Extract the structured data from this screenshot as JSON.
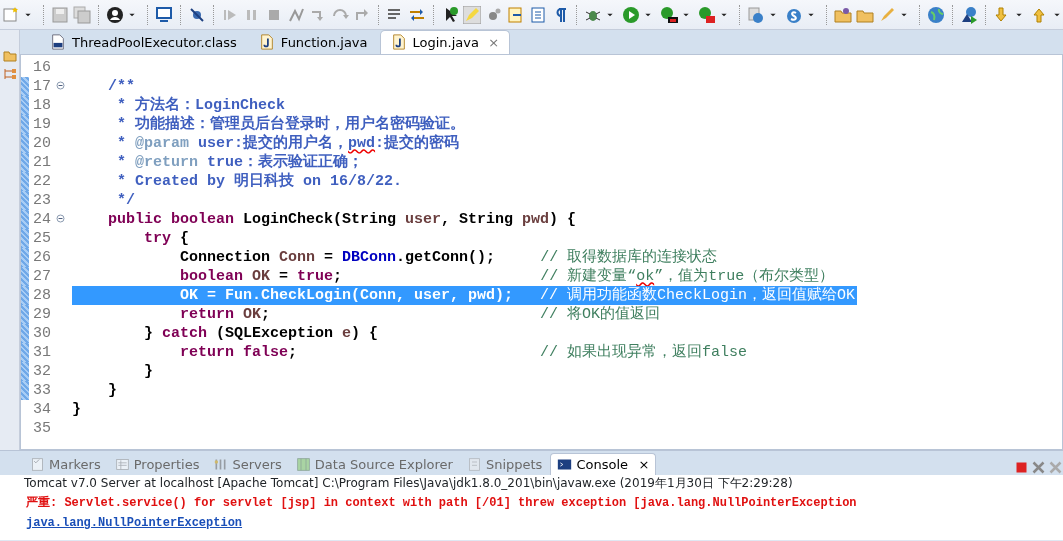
{
  "editor_tabs": [
    {
      "label": "ThreadPoolExecutor.class",
      "kind": "class",
      "selected": false
    },
    {
      "label": "Function.java",
      "kind": "java",
      "selected": false
    },
    {
      "label": "Login.java",
      "kind": "java",
      "selected": true,
      "close": "×"
    }
  ],
  "code_lines": [
    {
      "number": "16",
      "foldable": false,
      "changed": false,
      "selected": false
    },
    {
      "number": "17",
      "foldable": true,
      "changed": true,
      "selected": false,
      "tokens": [
        {
          "kind": "doc",
          "text": "    /**"
        }
      ]
    },
    {
      "number": "18",
      "foldable": false,
      "changed": true,
      "selected": false,
      "tokens": [
        {
          "kind": "doc",
          "text": "     * 方法名：LoginCheck"
        }
      ]
    },
    {
      "number": "19",
      "foldable": false,
      "changed": true,
      "selected": false,
      "tokens": [
        {
          "kind": "doc",
          "text": "     * 功能描述：管理员后台登录时，用户名密码验证。"
        }
      ]
    },
    {
      "number": "20",
      "foldable": false,
      "changed": true,
      "selected": false,
      "tokens": [
        {
          "kind": "doc",
          "text": "     * "
        },
        {
          "kind": "tag",
          "text": "@param"
        },
        {
          "kind": "doc",
          "text": " user:提交的用户名，"
        },
        {
          "kind": "doc-typo",
          "text": "pwd"
        },
        {
          "kind": "doc",
          "text": ":提交的密码"
        }
      ]
    },
    {
      "number": "21",
      "foldable": false,
      "changed": true,
      "selected": false,
      "tokens": [
        {
          "kind": "doc",
          "text": "     * "
        },
        {
          "kind": "tag",
          "text": "@return"
        },
        {
          "kind": "doc",
          "text": " true：表示验证正确；"
        }
      ]
    },
    {
      "number": "22",
      "foldable": false,
      "changed": true,
      "selected": false,
      "tokens": [
        {
          "kind": "doc",
          "text": "     * Created by 明日科技 on 16/8/22."
        }
      ]
    },
    {
      "number": "23",
      "foldable": false,
      "changed": true,
      "selected": false,
      "tokens": [
        {
          "kind": "doc",
          "text": "     */"
        }
      ]
    },
    {
      "number": "24",
      "foldable": true,
      "changed": true,
      "selected": false,
      "tokens": [
        {
          "kind": "keyword",
          "text": "    public boolean"
        },
        {
          "kind": "plain",
          "text": " LoginCheck(String "
        },
        {
          "kind": "variable",
          "text": "user"
        },
        {
          "kind": "plain",
          "text": ", String "
        },
        {
          "kind": "variable",
          "text": "pwd"
        },
        {
          "kind": "plain",
          "text": ") {"
        }
      ]
    },
    {
      "number": "25",
      "foldable": false,
      "changed": true,
      "selected": false,
      "tokens": [
        {
          "kind": "keyword",
          "text": "        try"
        },
        {
          "kind": "plain",
          "text": " {"
        }
      ]
    },
    {
      "number": "26",
      "foldable": false,
      "changed": true,
      "selected": false,
      "tokens": [
        {
          "kind": "plain",
          "text": "            Connection "
        },
        {
          "kind": "variable",
          "text": "Conn"
        },
        {
          "kind": "plain",
          "text": " = "
        },
        {
          "kind": "static",
          "text": "DBConn"
        },
        {
          "kind": "plain",
          "text": ".getConn();     "
        },
        {
          "kind": "comment",
          "text": "// 取得数据库的连接状态"
        }
      ]
    },
    {
      "number": "27",
      "foldable": false,
      "changed": true,
      "selected": false,
      "tokens": [
        {
          "kind": "keyword",
          "text": "            boolean "
        },
        {
          "kind": "variable",
          "text": "OK"
        },
        {
          "kind": "plain",
          "text": " = "
        },
        {
          "kind": "keyword",
          "text": "true"
        },
        {
          "kind": "plain",
          "text": ";                      "
        },
        {
          "kind": "comment",
          "text": "// 新建变量“"
        },
        {
          "kind": "comment-typo",
          "text": "ok"
        },
        {
          "kind": "comment",
          "text": "”，值为true（布尔类型）"
        }
      ]
    },
    {
      "number": "28",
      "foldable": false,
      "changed": true,
      "selected": true,
      "tokens": [
        {
          "kind": "plain",
          "text": "            OK = Fun.CheckLogin(Conn, user, pwd);   "
        },
        {
          "kind": "comment",
          "text": "// 调用功能函数CheckLogin，返回值赋给OK"
        }
      ]
    },
    {
      "number": "29",
      "foldable": false,
      "changed": true,
      "selected": false,
      "tokens": [
        {
          "kind": "keyword",
          "text": "            return "
        },
        {
          "kind": "variable",
          "text": "OK"
        },
        {
          "kind": "plain",
          "text": ";                              "
        },
        {
          "kind": "comment",
          "text": "// 将OK的值返回"
        }
      ]
    },
    {
      "number": "30",
      "foldable": false,
      "changed": true,
      "selected": false,
      "tokens": [
        {
          "kind": "plain",
          "text": "        } "
        },
        {
          "kind": "keyword",
          "text": "catch"
        },
        {
          "kind": "plain",
          "text": " (SQLException "
        },
        {
          "kind": "variable",
          "text": "e"
        },
        {
          "kind": "plain",
          "text": ") {"
        }
      ]
    },
    {
      "number": "31",
      "foldable": false,
      "changed": true,
      "selected": false,
      "tokens": [
        {
          "kind": "keyword",
          "text": "            return false"
        },
        {
          "kind": "plain",
          "text": ";                           "
        },
        {
          "kind": "comment",
          "text": "// 如果出现异常，返回false"
        }
      ]
    },
    {
      "number": "32",
      "foldable": false,
      "changed": true,
      "selected": false,
      "tokens": [
        {
          "kind": "plain",
          "text": "        }"
        }
      ]
    },
    {
      "number": "33",
      "foldable": false,
      "changed": true,
      "selected": false,
      "tokens": [
        {
          "kind": "plain",
          "text": "    }"
        }
      ]
    },
    {
      "number": "34",
      "foldable": false,
      "changed": false,
      "selected": false,
      "tokens": [
        {
          "kind": "plain",
          "text": "}"
        }
      ]
    },
    {
      "number": "35",
      "foldable": false,
      "changed": false,
      "selected": false
    }
  ],
  "view_tabs": [
    {
      "label": "Markers",
      "selected": false
    },
    {
      "label": "Properties",
      "selected": false
    },
    {
      "label": "Servers",
      "selected": false
    },
    {
      "label": "Data Source Explorer",
      "selected": false
    },
    {
      "label": "Snippets",
      "selected": false
    },
    {
      "label": "Console",
      "selected": true,
      "close": "×"
    }
  ],
  "console": {
    "process": "Tomcat v7.0 Server at localhost [Apache Tomcat] C:\\Program Files\\Java\\jdk1.8.0_201\\bin\\javaw.exe (2019年1月30日 下午2:29:28)",
    "output": [
      {
        "kind": "error",
        "text": "严重: Servlet.service() for servlet [jsp] in context with path [/01] threw exception [java.lang.NullPointerException"
      },
      {
        "kind": "link",
        "text": "java.lang.NullPointerException"
      }
    ]
  }
}
